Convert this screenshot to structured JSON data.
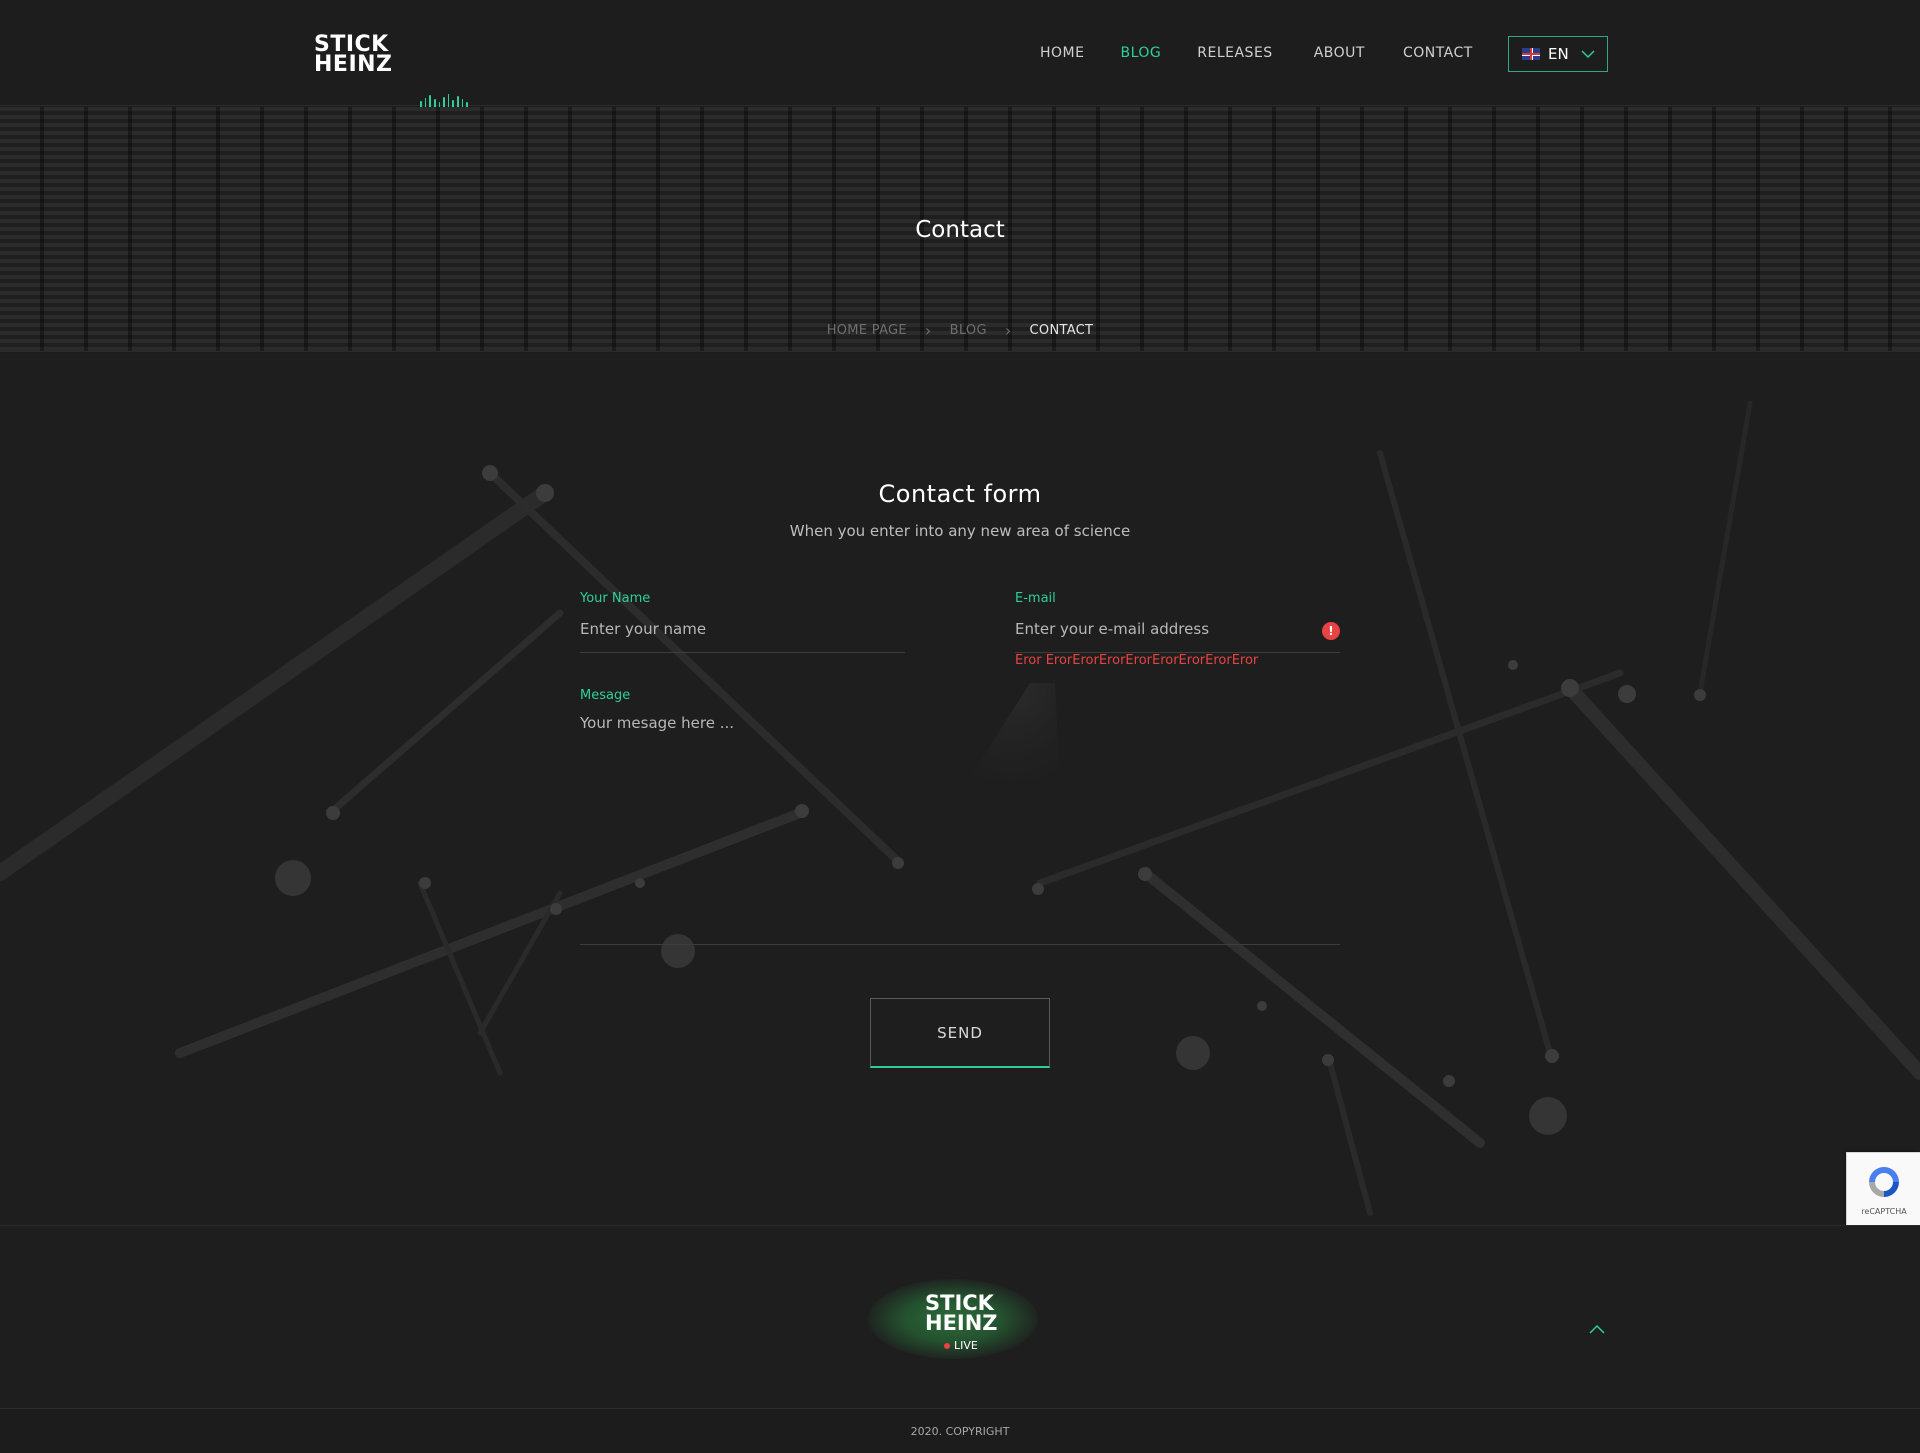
{
  "header": {
    "logo_line1": "STICK",
    "logo_line2": "HEINZ",
    "nav": [
      {
        "label": "HOME",
        "active": false
      },
      {
        "label": "BLOG",
        "active": true
      },
      {
        "label": "RELEASES",
        "active": false
      },
      {
        "label": "ABOUT",
        "active": false
      },
      {
        "label": "CONTACT",
        "active": false
      }
    ],
    "language": {
      "label": "EN",
      "flag_icon": "uk-flag-icon"
    }
  },
  "banner": {
    "title": "Contact",
    "breadcrumb": [
      {
        "label": "HOME PAGE"
      },
      {
        "label": "BLOG"
      },
      {
        "label": "CONTACT"
      }
    ]
  },
  "form": {
    "title": "Contact form",
    "subtitle": "When you enter into any new area of science",
    "name": {
      "label": "Your Name",
      "placeholder": "Enter your name"
    },
    "email": {
      "label": "E-mail",
      "placeholder": "Enter your e-mail address",
      "error": "Eror ErorErorErorErorErorErorErorEror"
    },
    "message": {
      "label": "Mesage",
      "placeholder": "Your mesage here ..."
    },
    "send_label": "SEND"
  },
  "recaptcha": {
    "label": "reCAPTCHA"
  },
  "footer": {
    "logo_line1": "STICK",
    "logo_line2": "HEINZ",
    "live_label": "LIVE",
    "copyright": "2020. COPYRIGHT"
  },
  "colors": {
    "accent": "#2ecf9a",
    "error": "#e84343",
    "background": "#1c1c1c"
  }
}
